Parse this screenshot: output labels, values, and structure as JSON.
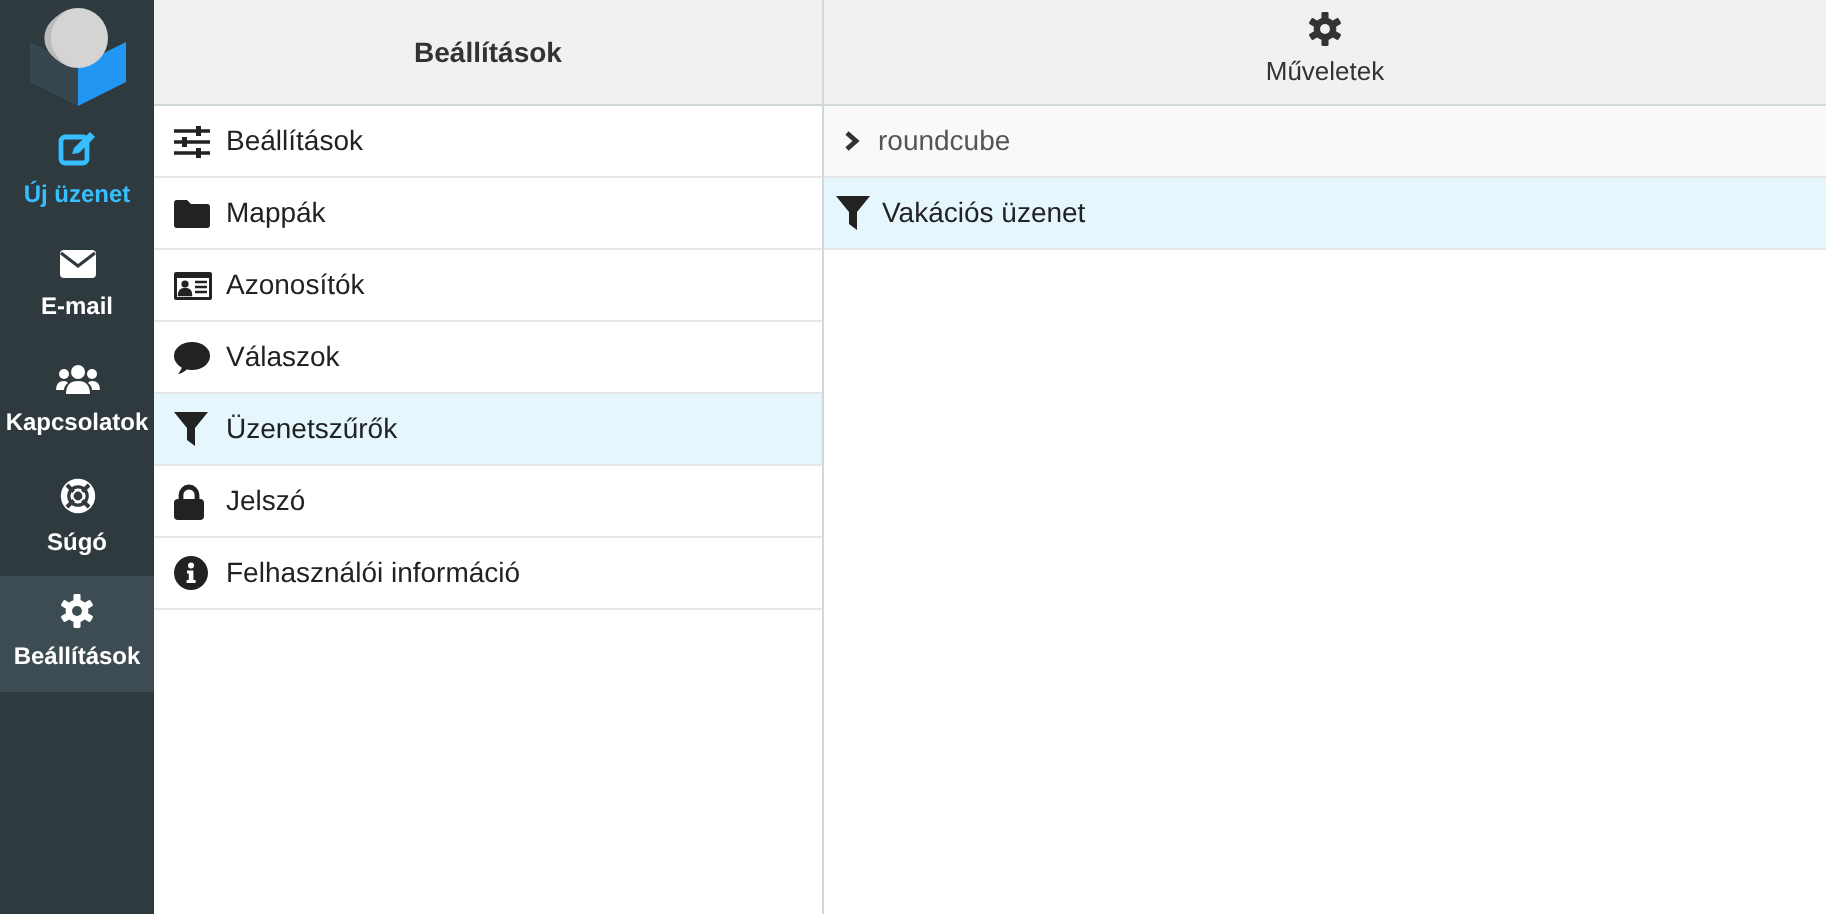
{
  "nav": [
    {
      "label": "Új üzenet",
      "kind": "compose",
      "primary": true,
      "selected": false
    },
    {
      "label": "E-mail",
      "kind": "mail",
      "primary": false,
      "selected": false
    },
    {
      "label": "Kapcsolatok",
      "kind": "contacts",
      "primary": false,
      "selected": false
    },
    {
      "label": "Súgó",
      "kind": "help",
      "primary": false,
      "selected": false
    },
    {
      "label": "Beállítások",
      "kind": "gear",
      "primary": false,
      "selected": true
    }
  ],
  "settings": {
    "title": "Beállítások",
    "items": [
      {
        "label": "Beállítások",
        "kind": "sliders",
        "selected": false
      },
      {
        "label": "Mappák",
        "kind": "folder",
        "selected": false
      },
      {
        "label": "Azonosítók",
        "kind": "idcard",
        "selected": false
      },
      {
        "label": "Válaszok",
        "kind": "comment",
        "selected": false
      },
      {
        "label": "Üzenetszűrők",
        "kind": "filter",
        "selected": true
      },
      {
        "label": "Jelszó",
        "kind": "lock",
        "selected": false
      },
      {
        "label": "Felhasználói információ",
        "kind": "info",
        "selected": false
      }
    ]
  },
  "filters": {
    "actions_label": "Műveletek",
    "set_name": "roundcube",
    "items": [
      {
        "label": "Vakációs üzenet",
        "selected": true
      }
    ]
  }
}
